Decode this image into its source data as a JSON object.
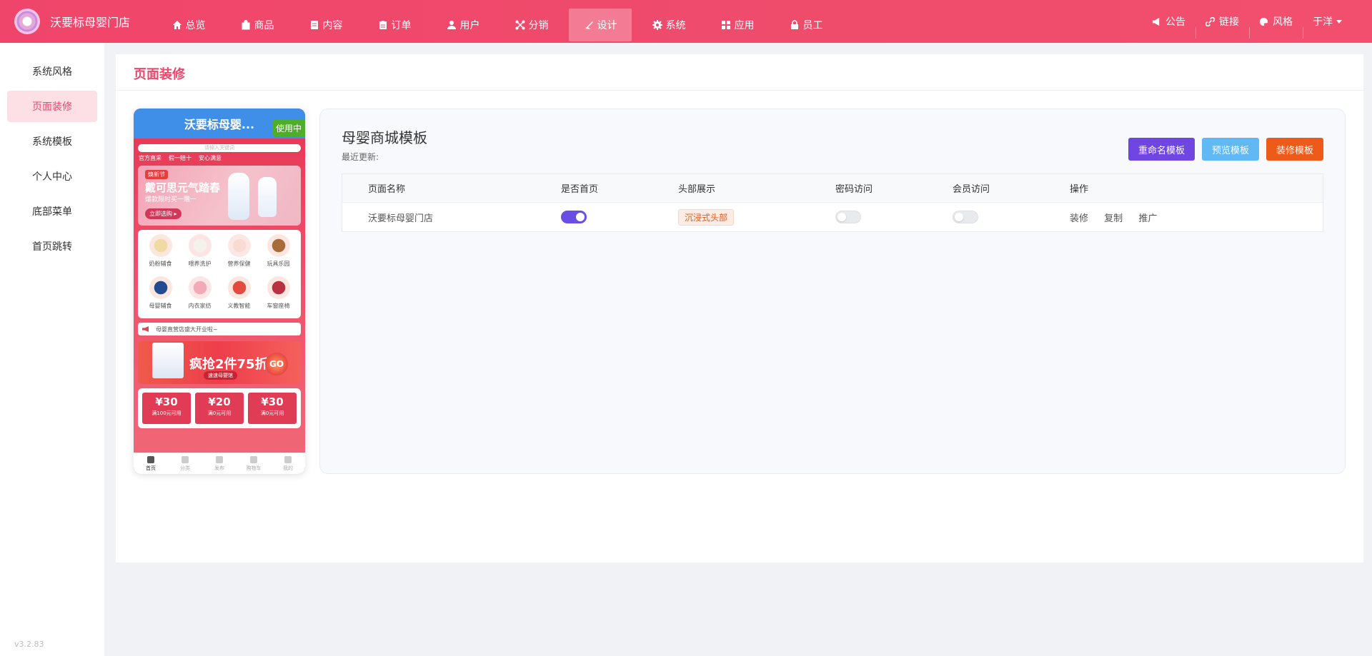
{
  "brand": {
    "name": "沃要标母婴门店"
  },
  "nav": [
    {
      "label": "总览",
      "icon": "home-icon"
    },
    {
      "label": "商品",
      "icon": "bag-icon"
    },
    {
      "label": "内容",
      "icon": "document-icon"
    },
    {
      "label": "订单",
      "icon": "clipboard-icon"
    },
    {
      "label": "用户",
      "icon": "user-icon"
    },
    {
      "label": "分销",
      "icon": "share-network-icon"
    },
    {
      "label": "设计",
      "icon": "brush-icon",
      "active": true
    },
    {
      "label": "系统",
      "icon": "gear-icon"
    },
    {
      "label": "应用",
      "icon": "grid-icon"
    },
    {
      "label": "员工",
      "icon": "lock-icon"
    }
  ],
  "tools": {
    "notice": "公告",
    "link": "链接",
    "style": "风格",
    "user": "于洋"
  },
  "sidebar": {
    "items": [
      "系统风格",
      "页面装修",
      "系统模板",
      "个人中心",
      "底部菜单",
      "首页跳转"
    ],
    "active_index": 1,
    "version": "v3.2.83"
  },
  "page": {
    "title": "页面装修"
  },
  "phone": {
    "title": "沃要标母婴...",
    "in_use": "使用中",
    "search_placeholder": "请输入关键词",
    "tags": [
      "官方直采",
      "假一赔十",
      "安心满意"
    ],
    "banner": {
      "badge": "焕新节",
      "title": "戴可思元气踏春",
      "sub": "爆款限时买一赠一",
      "cta": "立即选购 ▸"
    },
    "categories": [
      "奶粉辅食",
      "喂养洗护",
      "营养保健",
      "玩具乐园",
      "母婴辅食",
      "内衣家纺",
      "义教智能",
      "车窗座椅"
    ],
    "notice": "母婴直营店盛大开业啦~",
    "promo": {
      "title": "疯抢2件75折",
      "sub": "速速母婴馆",
      "go": "GO"
    },
    "coupons": [
      {
        "value": "¥30",
        "cond": "满100元可用"
      },
      {
        "value": "¥20",
        "cond": "满0元可用"
      },
      {
        "value": "¥30",
        "cond": "满0元可用"
      }
    ],
    "tabbar": [
      "首页",
      "分类",
      "发布",
      "购物车",
      "我的"
    ]
  },
  "template": {
    "title": "母婴商城模板",
    "updated_label": "最近更新:",
    "buttons": {
      "rename": "重命名模板",
      "preview": "预览模板",
      "decorate": "装修模板"
    },
    "headers": [
      "页面名称",
      "是否首页",
      "头部展示",
      "密码访问",
      "会员访问",
      "操作"
    ],
    "rows": [
      {
        "name": "沃要标母婴门店",
        "is_home": true,
        "header_style": "沉浸式头部",
        "password_access": false,
        "member_access": false,
        "actions": [
          "装修",
          "复制",
          "推广"
        ]
      }
    ]
  },
  "colors": {
    "primary": "#f0456a",
    "rename": "#7046e3",
    "preview": "#60b8f5",
    "decorate": "#ee5a1a",
    "switch_on": "#6a4ee3"
  }
}
